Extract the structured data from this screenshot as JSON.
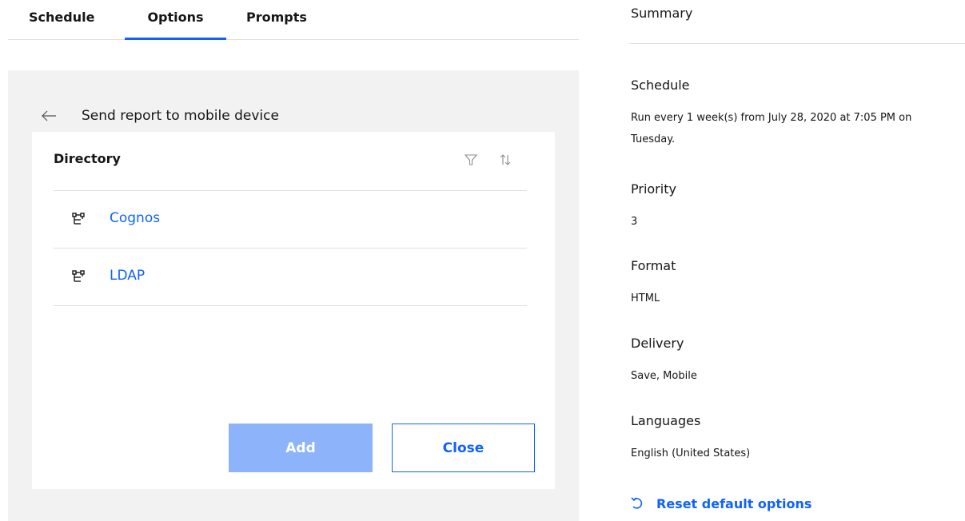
{
  "tabs": [
    {
      "label": "Schedule"
    },
    {
      "label": "Options"
    },
    {
      "label": "Prompts"
    }
  ],
  "dialog": {
    "title": "Send report to mobile device",
    "list_header": "Directory",
    "items": [
      {
        "label": "Cognos"
      },
      {
        "label": "LDAP"
      }
    ],
    "add_label": "Add",
    "close_label": "Close"
  },
  "summary": {
    "title": "Summary",
    "sections": [
      {
        "heading": "Schedule",
        "value": "Run every 1 week(s) from July 28, 2020 at 7:05 PM on Tuesday."
      },
      {
        "heading": "Priority",
        "value": "3"
      },
      {
        "heading": "Format",
        "value": "HTML"
      },
      {
        "heading": "Delivery",
        "value": "Save, Mobile"
      },
      {
        "heading": "Languages",
        "value": "English (United States)"
      }
    ],
    "reset_label": "Reset default options"
  },
  "colors": {
    "accent": "#0f62fe",
    "add_button_disabled": "#8db4fb",
    "panel_bg": "#f2f2f2"
  },
  "icons": {
    "back": "arrow-left-icon",
    "filter": "filter-icon",
    "sort": "sort-icon",
    "directory": "hierarchy-icon",
    "reset": "reset-icon"
  }
}
